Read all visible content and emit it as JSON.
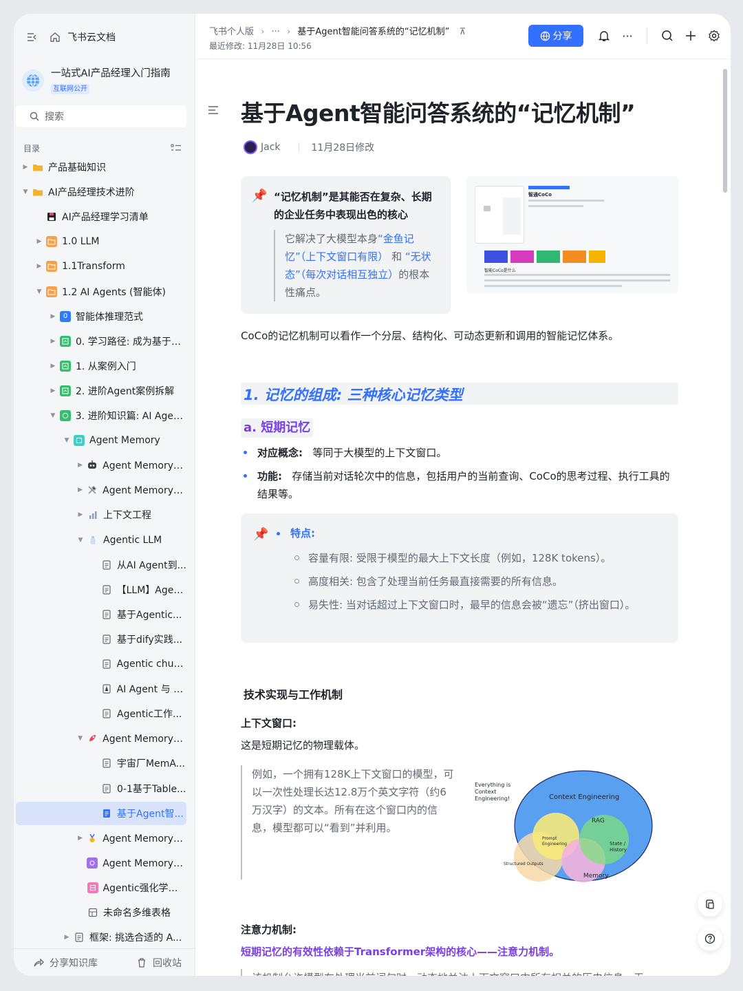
{
  "sidebar": {
    "app_title": "飞书云文档",
    "kb_title": "一站式AI产品经理入门指南",
    "kb_badge": "互联网公开",
    "search_placeholder": "搜索",
    "toc_label": "目录",
    "tree": [
      {
        "label": "产品基础知识",
        "level": 0,
        "caret": "right",
        "icon": "folder-yellow"
      },
      {
        "label": "AI产品经理技术进阶",
        "level": 0,
        "caret": "down",
        "icon": "folder-yellow"
      },
      {
        "label": "AI产品经理学习清单",
        "level": 1,
        "caret": "",
        "icon": "floppy"
      },
      {
        "label": "1.0 LLM",
        "level": 1,
        "caret": "right",
        "icon": "folder-orange"
      },
      {
        "label": "1.1Transform",
        "level": 1,
        "caret": "right",
        "icon": "folder-orange"
      },
      {
        "label": "1.2 AI Agents (智能体)",
        "level": 1,
        "caret": "down",
        "icon": "folder-orange"
      },
      {
        "label": "智能体推理范式",
        "level": 2,
        "caret": "right",
        "icon": "blue-0"
      },
      {
        "label": "0. 学习路径: 成为基于A...",
        "level": 2,
        "caret": "right",
        "icon": "green-sheet"
      },
      {
        "label": "1. 从案例入门",
        "level": 2,
        "caret": "right",
        "icon": "green-sheet"
      },
      {
        "label": "2. 进阶Agent案例拆解",
        "level": 2,
        "caret": "right",
        "icon": "green-sheet"
      },
      {
        "label": "3. 进阶知识篇: AI Agen...",
        "level": 2,
        "caret": "down",
        "icon": "green-check"
      },
      {
        "label": "Agent Memory",
        "level": 3,
        "caret": "down",
        "icon": "teal"
      },
      {
        "label": "Agent Memory入门",
        "level": 4,
        "caret": "right",
        "icon": "robot"
      },
      {
        "label": "Agent Memory实现",
        "level": 4,
        "caret": "right",
        "icon": "tools"
      },
      {
        "label": "上下文工程",
        "level": 4,
        "caret": "right",
        "icon": "chart"
      },
      {
        "label": "Agentic LLM",
        "level": 4,
        "caret": "down",
        "icon": "bottle"
      },
      {
        "label": "从AI Agent到...",
        "level": 5,
        "caret": "",
        "icon": "doc"
      },
      {
        "label": "【LLM】Agen...",
        "level": 5,
        "caret": "",
        "icon": "doc"
      },
      {
        "label": "基于Agentic...",
        "level": 5,
        "caret": "",
        "icon": "doc"
      },
      {
        "label": "基于dify实践...",
        "level": 5,
        "caret": "",
        "icon": "doc"
      },
      {
        "label": "Agentic chun...",
        "level": 5,
        "caret": "",
        "icon": "doc"
      },
      {
        "label": "AI Agent 与 A...",
        "level": 5,
        "caret": "",
        "icon": "pdf"
      },
      {
        "label": "Agentic工作...",
        "level": 5,
        "caret": "",
        "icon": "doc"
      },
      {
        "label": "Agent Memory搭建",
        "level": 4,
        "caret": "down",
        "icon": "rocket"
      },
      {
        "label": "宇宙厂MemA...",
        "level": 5,
        "caret": "",
        "icon": "doc"
      },
      {
        "label": "0-1基于Table...",
        "level": 5,
        "caret": "",
        "icon": "doc"
      },
      {
        "label": "基于Agent智...",
        "level": 5,
        "caret": "",
        "icon": "doc-blue",
        "selected": true
      },
      {
        "label": "Agent Memory项...",
        "level": 4,
        "caret": "right",
        "icon": "medal"
      },
      {
        "label": "Agent Memory必...",
        "level": 4,
        "caret": "",
        "icon": "purple"
      },
      {
        "label": "Agentic强化学习....",
        "level": 4,
        "caret": "",
        "icon": "pink"
      },
      {
        "label": "未命名多维表格",
        "level": 4,
        "caret": "",
        "icon": "grid"
      },
      {
        "label": "框架: 挑选合适的 A...",
        "level": 3,
        "caret": "right",
        "icon": "doc"
      }
    ],
    "footer_share": "分享知识库",
    "footer_trash": "回收站"
  },
  "topbar": {
    "breadcrumb_root": "飞书个人版",
    "breadcrumb_more": "···",
    "breadcrumb_current": "基于Agent智能问答系统的“记忆机制”",
    "last_modified": "最近修改: 11月28日 10:56",
    "share_label": "分享"
  },
  "doc": {
    "title": "基于Agent智能问答系统的“记忆机制”",
    "author": "Jack",
    "modified": "11月28日修改",
    "callout1_heading": "“记忆机制”是其能否在复杂、长期的企业任务中表现出色的核心",
    "callout1_q1": "它解决了大模型本身",
    "callout1_q2": "“金鱼记忆”（上下文窗口有限）",
    "callout1_q3": "和",
    "callout1_q4": "“无状态”（每次对话相互独立）",
    "callout1_q5": "的根本性痛点。",
    "shot_title": "智通CoCo",
    "shot_sub": "智能CoCo是什么",
    "intro": "CoCo的记忆机制可以看作一个分层、结构化、可动态更新和调用的智能记忆体系。",
    "h1": "1. 记忆的组成: 三种核心记忆类型",
    "h2": "a. 短期记忆",
    "b1_label": "对应概念:",
    "b1_text": "等同于大模型的上下文窗口。",
    "b2_label": "功能:",
    "b2_text": "存储当前对话轮次中的信息，包括用户的当前查询、CoCo的思考过程、执行工具的结果等。",
    "feat_label": "特点:",
    "feat1": "容量有限: 受限于模型的最大上下文长度（例如，128K tokens）。",
    "feat2": "高度相关: 包含了处理当前任务最直接需要的所有信息。",
    "feat3": "易失性: 当对话超过上下文窗口时，最早的信息会被“遗忘”（挤出窗口）。",
    "section": "技术实现与工作机制",
    "ctx_label": "上下文窗口:",
    "ctx_text": "这是短期记忆的物理载体。",
    "quote2": "例如，一个拥有128K上下文窗口的模型，可以一次性处理长达12.8万个英文字符（约6万汉字）的文本。所有在这个窗口内的信息，模型都可以“看到”并利用。",
    "venn_note": "Everything is Context Engineering!",
    "venn_outer": "Context Engineering",
    "venn_rag": "RAG",
    "venn_prompt": "Prompt Engineering",
    "venn_state": "State / History",
    "venn_structured": "Structured Outputs",
    "venn_memory": "Memory",
    "attn_label": "注意力机制:",
    "attn_title": "短期记忆的有效性依赖于Transformer架构的核心——注意力机制。",
    "attn_cut": "该机制允许模型在处理当前词句时，动态地关注上下文窗口中所有相关的历史信息，无"
  },
  "colors": {
    "accent": "#3370ff",
    "purple": "#7a3fe4"
  }
}
